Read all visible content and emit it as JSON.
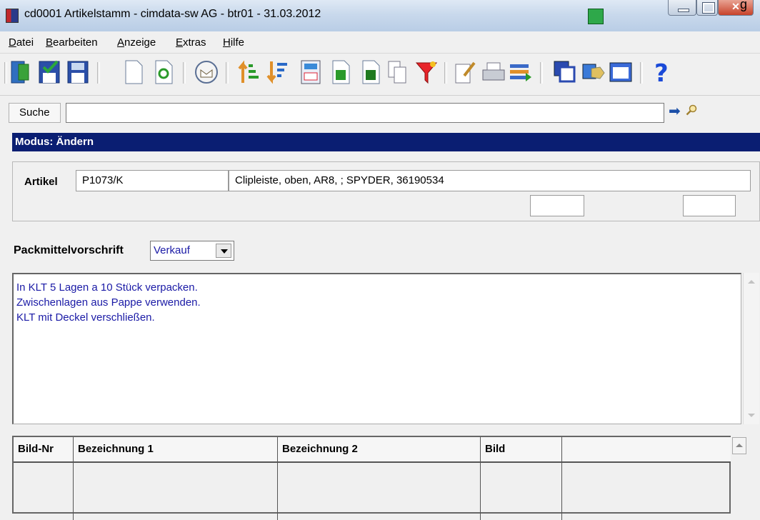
{
  "window": {
    "title": "cd0001 Artikelstamm - cimdata-sw AG - btr01 - 31.03.2012",
    "corner_text": "g"
  },
  "menu": [
    "Datei",
    "Bearbeiten",
    "Anzeige",
    "Extras",
    "Hilfe"
  ],
  "toolbar": {
    "icons": [
      "exit-icon",
      "save-close-icon",
      "save-icon",
      "new-document-icon",
      "refresh-icon",
      "mail-icon",
      "sort-ascending-icon",
      "sort-descending-icon",
      "calculator-icon",
      "export-icon",
      "excel-icon",
      "copy-icon",
      "filter-icon",
      "edit-icon",
      "print-icon",
      "list-icon",
      "windows-icon",
      "tag-icon",
      "grid-icon",
      "help-icon"
    ]
  },
  "search": {
    "label": "Suche",
    "value": ""
  },
  "mode": {
    "text": "Modus: Ändern"
  },
  "artikel": {
    "label": "Artikel",
    "code": "P1073/K",
    "description": "Clipleiste, oben, AR8, ; SPYDER, 36190534"
  },
  "pack": {
    "label": "Packmittelvorschrift",
    "selected": "Verkauf"
  },
  "memo": {
    "lines": [
      "In KLT  5 Lagen a 10 Stück verpacken.",
      "Zwischenlagen aus Pappe verwenden.",
      "KLT mit Deckel verschließen."
    ]
  },
  "grid": {
    "columns": [
      "Bild-Nr",
      "Bezeichnung 1",
      "Bezeichnung 2",
      "Bild",
      ""
    ]
  },
  "colors": {
    "mode_bar": "#0a1e72",
    "memo_text": "#1a1aa6"
  }
}
